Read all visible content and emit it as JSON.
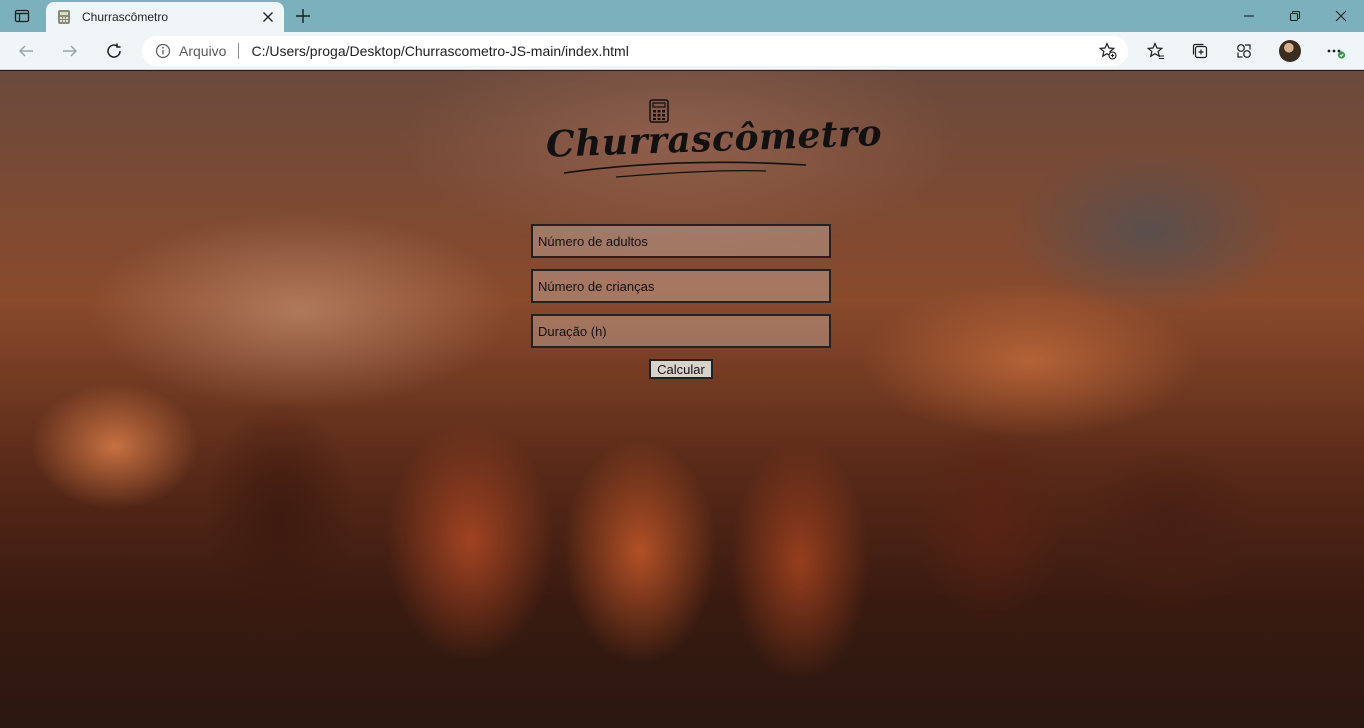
{
  "browser": {
    "tab": {
      "title": "Churrascômetro"
    },
    "address": {
      "site_label": "Arquivo",
      "url": "C:/Users/proga/Desktop/Churrascometro-JS-main/index.html"
    }
  },
  "page": {
    "logo_text": "Churrascômetro",
    "form": {
      "adults_placeholder": "Número de adultos",
      "children_placeholder": "Número de crianças",
      "duration_placeholder": "Duração (h)",
      "calculate_label": "Calcular"
    }
  },
  "colors": {
    "tabbar": "#7ab1bc",
    "toolbar": "#f0f6f8",
    "logo": "#111111"
  },
  "icons": [
    "tab-actions-icon",
    "favicon-icon",
    "close-icon",
    "plus-icon",
    "minimize-icon",
    "restore-icon",
    "window-close-icon",
    "back-icon",
    "forward-icon",
    "refresh-icon",
    "info-icon",
    "add-favorite-icon",
    "favorites-icon",
    "collections-icon",
    "extensions-icon",
    "more-icon",
    "calculator-icon"
  ]
}
